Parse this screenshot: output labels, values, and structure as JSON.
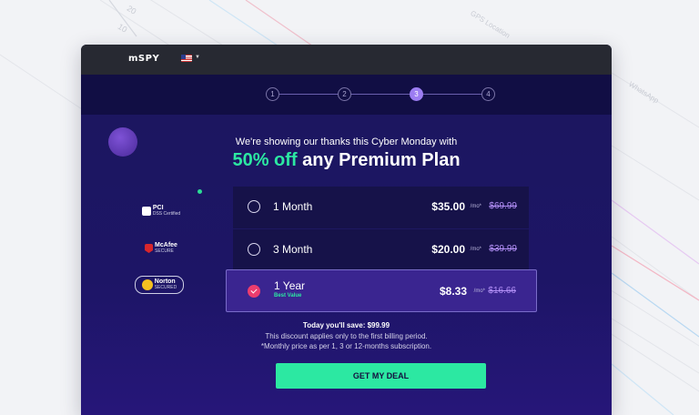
{
  "background": {
    "labels": [
      "20",
      "10",
      "GPS Location",
      "WhatsApp"
    ]
  },
  "header": {
    "logo_text": "SPY",
    "logo_prefix": "m",
    "flag": "us-flag-icon"
  },
  "steps": {
    "items": [
      "1",
      "2",
      "3",
      "4"
    ],
    "active_index": 2
  },
  "promo": {
    "intro": "We're showing our thanks this Cyber Monday with",
    "highlight": "50% off",
    "rest": " any Premium Plan"
  },
  "badges": [
    {
      "label": "PCI",
      "sub": "DSS Certified"
    },
    {
      "label": "McAfee",
      "sub": "SECURE"
    },
    {
      "label": "Norton",
      "sub": "SECURED"
    }
  ],
  "plans": [
    {
      "name": "1 Month",
      "price": "$35.00",
      "unit": "/mo*",
      "old_price": "$69.99",
      "selected": false
    },
    {
      "name": "3 Month",
      "price": "$20.00",
      "unit": "/mo*",
      "old_price": "$39.99",
      "selected": false
    },
    {
      "name": "1 Year",
      "badge": "Best Value",
      "price": "$8.33",
      "unit": "/mo*",
      "old_price": "$16.66",
      "selected": true
    }
  ],
  "summary": {
    "savings": "Today you'll save: $99.99",
    "note1": "This discount applies only to the first billing period.",
    "note2": "*Monthly price as per 1, 3 or 12-months subscription."
  },
  "cta": {
    "label": "GET MY DEAL"
  },
  "colors": {
    "accent_green": "#2ce8a2",
    "accent_purple": "#9c7df2",
    "selected_check": "#ec3d6e",
    "panel_bg": "#1b165c"
  }
}
